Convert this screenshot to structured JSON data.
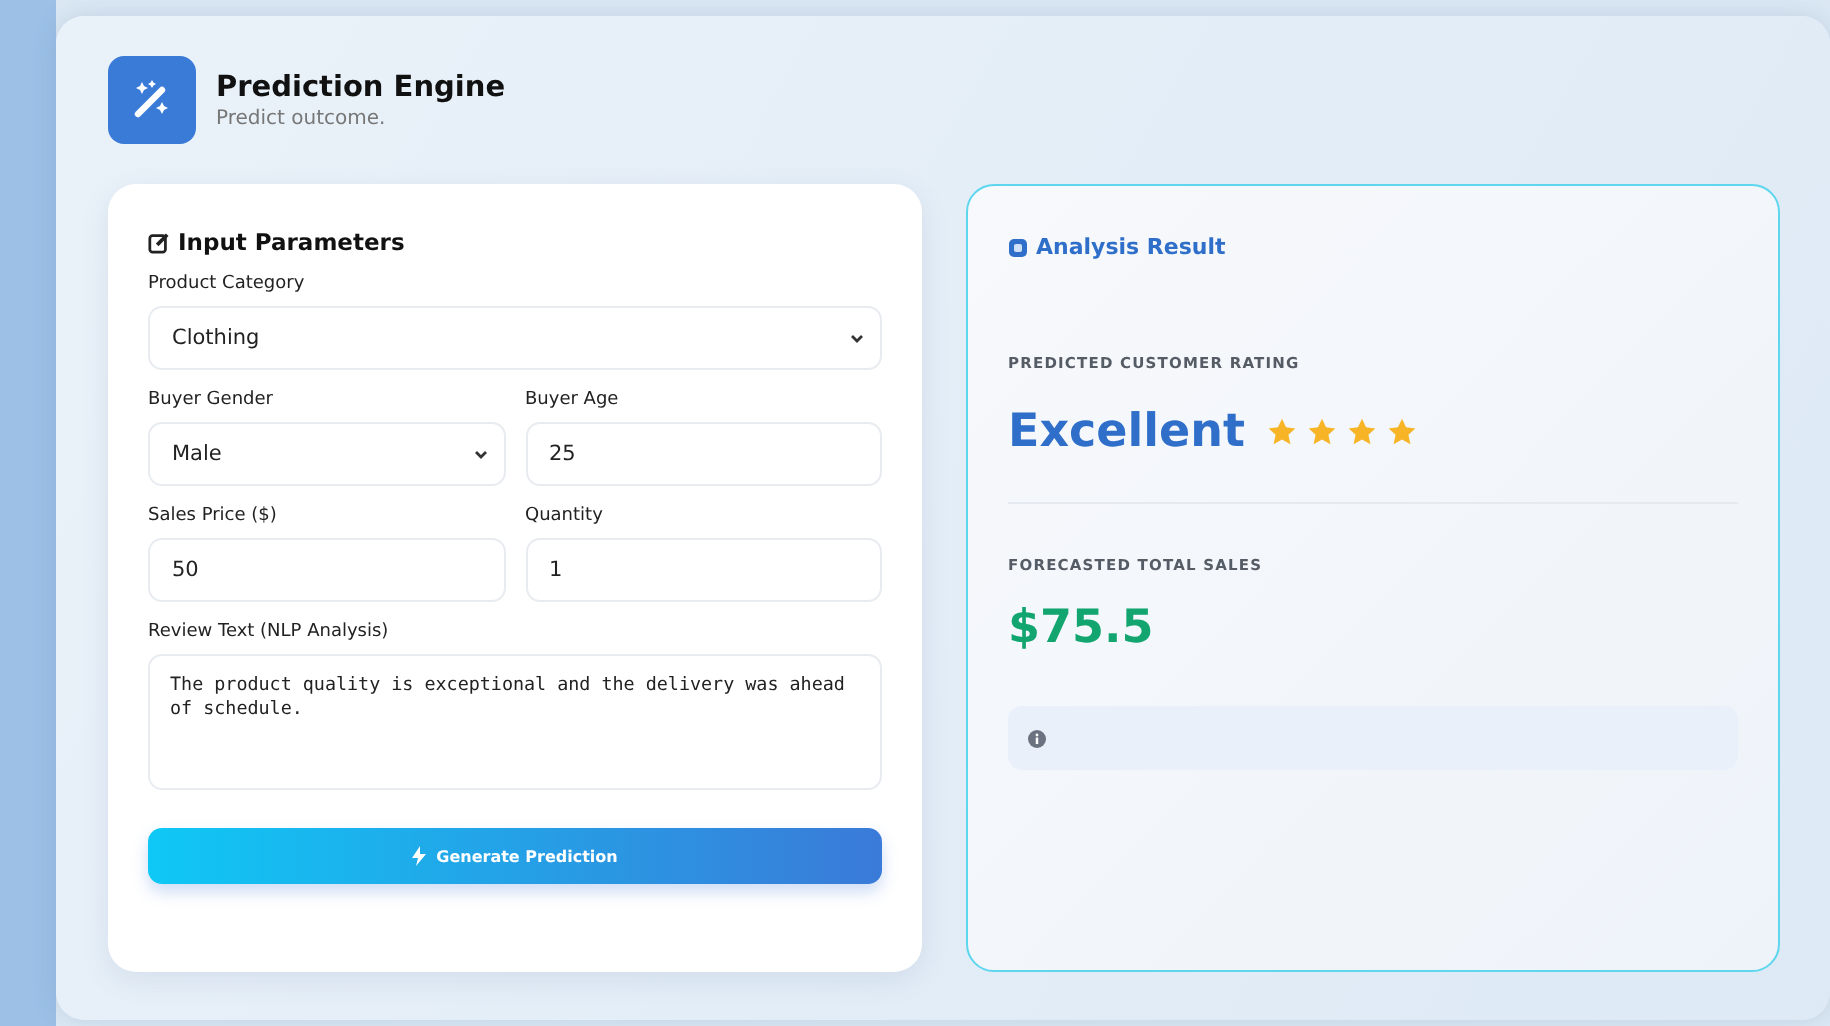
{
  "header": {
    "title": "Prediction Engine",
    "subtitle": "Predict outcome."
  },
  "input_panel": {
    "title": "Input Parameters",
    "field_rows": [
      [
        {
          "label": "Product Category",
          "kind": "select",
          "value": "Clothing"
        }
      ],
      [
        {
          "label": "Buyer Gender",
          "kind": "select",
          "value": "Male"
        },
        {
          "label": "Buyer Age",
          "kind": "input",
          "value": "25"
        }
      ],
      [
        {
          "label": "Sales Price ($)",
          "kind": "input",
          "value": "50"
        },
        {
          "label": "Quantity",
          "kind": "input",
          "value": "1"
        }
      ],
      [
        {
          "label": "Review Text (NLP Analysis)",
          "kind": "textarea",
          "value": "The product quality is exceptional and the delivery was ahead of schedule."
        }
      ]
    ],
    "button": "Generate Prediction"
  },
  "result_panel": {
    "title": "Analysis Result",
    "rating_label": "PREDICTED CUSTOMER RATING",
    "rating": "Excellent",
    "stars": 4,
    "sales_label": "FORECASTED TOTAL SALES",
    "sales": "$75.5"
  }
}
